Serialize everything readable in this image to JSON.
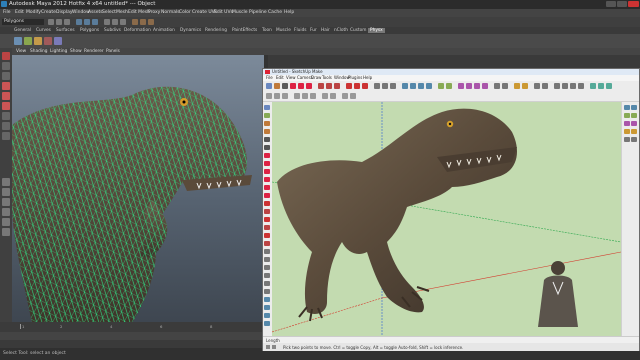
{
  "maya": {
    "title": "Autodesk Maya 2012 Hotfix 4 x64 untitled*   ---   Object",
    "menus": [
      "File",
      "Edit",
      "Modify",
      "Create",
      "Display",
      "Window",
      "Assets",
      "Select",
      "Mesh",
      "Edit Mesh",
      "Proxy",
      "Normals",
      "Color",
      "Create UVs",
      "Edit UVs",
      "Muscle",
      "Pipeline Cache",
      "Help"
    ],
    "mode": "Polygons",
    "shelf_tabs": [
      "General",
      "Curves",
      "Surfaces",
      "Polygons",
      "Subdivs",
      "Deformation",
      "Animation",
      "Dynamics",
      "Rendering",
      "PaintEffects",
      "Toon",
      "Muscle",
      "Fluids",
      "Fur",
      "Hair",
      "nCloth",
      "Custom",
      "Physx"
    ],
    "active_shelf_tab": "Physx",
    "panel_menus": [
      "View",
      "Shading",
      "Lighting",
      "Show",
      "Renderer",
      "Panels"
    ],
    "help_line": "Select Tool: select an object",
    "timeline_ticks": [
      "1",
      "2",
      "4",
      "6",
      "8",
      "10",
      "12",
      "14",
      "16",
      "18",
      "20",
      "22",
      "24"
    ]
  },
  "sketchup": {
    "title": "Untitled - SketchUp Make",
    "menus": [
      "File",
      "Edit",
      "View",
      "Camera",
      "Draw",
      "Tools",
      "Window",
      "Plugins",
      "Help"
    ],
    "measurements_label": "Length",
    "status_text": "Pick two points to move.  Ctrl = toggle Copy, Alt = toggle Auto-fold, Shift = lock inference."
  },
  "colors": {
    "maya_bg": "#444444",
    "wireframe": "#2ee88a",
    "sketchup_ground": "#c3dbb0",
    "axis_red": "#d33a2c",
    "axis_green": "#2fa84f",
    "axis_blue": "#2f5fd6"
  }
}
